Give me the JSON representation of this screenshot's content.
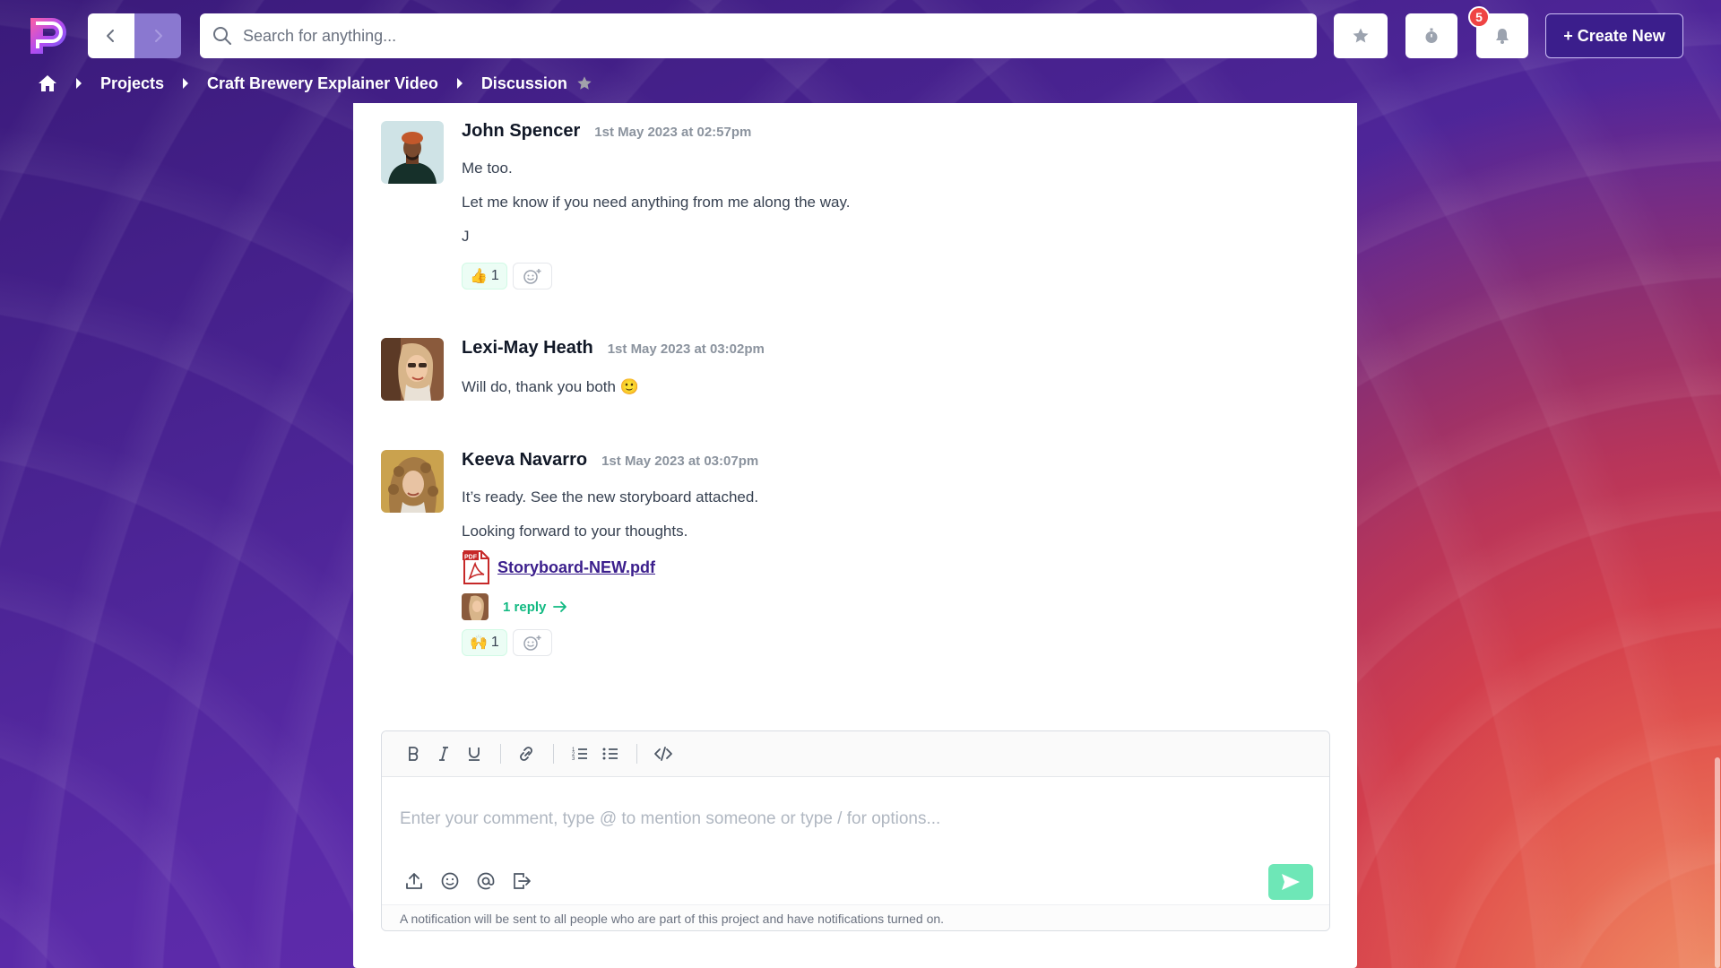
{
  "app": {
    "brand_colors": {
      "accent": "#3b1e8c",
      "success": "#10b981",
      "badge": "#ef4444"
    }
  },
  "topbar": {
    "search_placeholder": "Search for anything...",
    "notifications_count": "5",
    "create_label": "+ Create New",
    "icons": [
      "chevron-left-icon",
      "chevron-right-icon",
      "search-icon",
      "star-icon",
      "stopwatch-icon",
      "bell-icon"
    ]
  },
  "breadcrumbs": [
    {
      "label": "Projects"
    },
    {
      "label": "Craft Brewery Explainer Video"
    },
    {
      "label": "Discussion"
    }
  ],
  "messages": [
    {
      "author": "John Spencer",
      "time": "1st May 2023 at 02:57pm",
      "lines": [
        "Me too.",
        "Let me know if you need anything from me along the way.",
        "J"
      ],
      "reaction": {
        "emoji": "👍",
        "count": "1"
      }
    },
    {
      "author": "Lexi-May Heath",
      "time": "1st May 2023 at 03:02pm",
      "lines": [
        "Will do, thank you both 🙂"
      ]
    },
    {
      "author": "Keeva Navarro",
      "time": "1st May 2023 at 03:07pm",
      "lines": [
        "It’s ready. See the new storyboard attached.",
        "Looking forward to your thoughts."
      ],
      "attachment": "Storyboard-NEW.pdf",
      "replies": "1 reply",
      "reaction": {
        "emoji": "🙌",
        "count": "1"
      }
    }
  ],
  "editor": {
    "placeholder": "Enter your comment, type @ to mention someone or type / for options...",
    "notice": "A notification will be sent to all people who are part of this project and have notifications turned on."
  }
}
